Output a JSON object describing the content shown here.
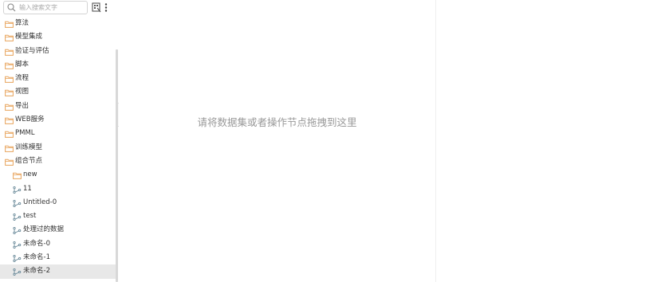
{
  "search": {
    "placeholder": "输入搜索文字"
  },
  "toolbar": {
    "icons": [
      "grid-icon",
      "more-vertical-icon"
    ]
  },
  "tree": {
    "folders": [
      {
        "label": "算法"
      },
      {
        "label": "模型集成"
      },
      {
        "label": "验证与评估"
      },
      {
        "label": "脚本"
      },
      {
        "label": "流程"
      },
      {
        "label": "视图"
      },
      {
        "label": "导出"
      },
      {
        "label": "WEB服务"
      },
      {
        "label": "PMML"
      },
      {
        "label": "训练模型"
      },
      {
        "label": "组合节点"
      }
    ],
    "children": [
      {
        "label": "new",
        "icon": "folder-icon"
      },
      {
        "label": "11",
        "icon": "flow-node-icon"
      },
      {
        "label": "Untitled-0",
        "icon": "flow-node-icon"
      },
      {
        "label": "test",
        "icon": "flow-node-icon"
      },
      {
        "label": "处理过的数据",
        "icon": "flow-node-icon"
      },
      {
        "label": "未命名-0",
        "icon": "flow-node-icon"
      },
      {
        "label": "未命名-1",
        "icon": "flow-node-icon"
      },
      {
        "label": "未命名-2",
        "icon": "flow-node-icon",
        "selected": true
      }
    ]
  },
  "canvas": {
    "hint": "请将数据集或者操作节点拖拽到这里"
  },
  "colors": {
    "folder": "#e8a45c",
    "node": "#6a8a9a",
    "selected_bg": "#e8e8e8"
  }
}
